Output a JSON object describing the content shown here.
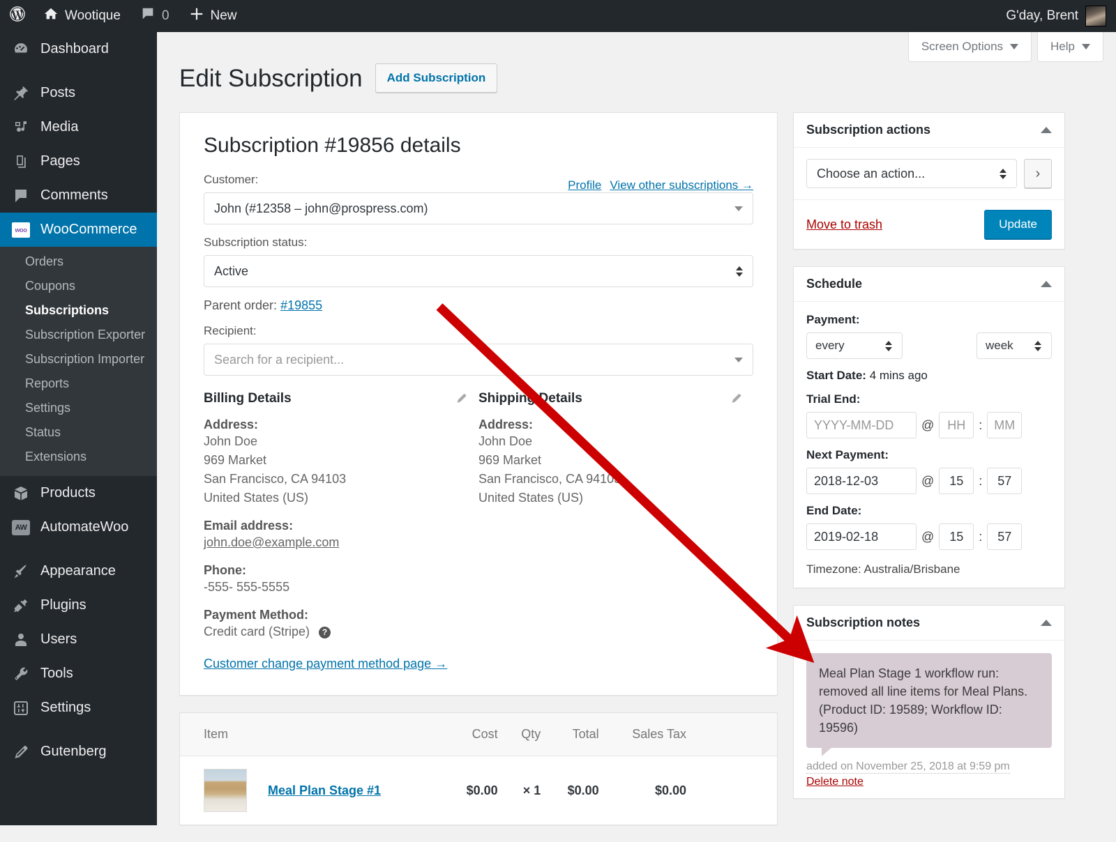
{
  "adminbar": {
    "logo_icon": "wordpress-logo-icon",
    "site_icon": "home-icon",
    "site_name": "Wootique",
    "comments_icon": "comment-bubble-icon",
    "comments_count": "0",
    "new_icon": "plus-icon",
    "new_label": "New",
    "greeting": "G'day, Brent",
    "avatar_icon": "user-avatar"
  },
  "sidebar": {
    "items": [
      {
        "label": "Dashboard",
        "icon": "dashboard-icon"
      },
      {
        "label": "Posts",
        "icon": "pin-icon"
      },
      {
        "label": "Media",
        "icon": "media-icon"
      },
      {
        "label": "Pages",
        "icon": "pages-icon"
      },
      {
        "label": "Comments",
        "icon": "comment-icon"
      },
      {
        "label": "WooCommerce",
        "icon": "woocommerce-icon"
      },
      {
        "label": "Products",
        "icon": "products-box-icon"
      },
      {
        "label": "AutomateWoo",
        "icon": "automatewoo-icon"
      },
      {
        "label": "Appearance",
        "icon": "paintbrush-icon"
      },
      {
        "label": "Plugins",
        "icon": "plug-icon"
      },
      {
        "label": "Users",
        "icon": "user-icon"
      },
      {
        "label": "Tools",
        "icon": "wrench-icon"
      },
      {
        "label": "Settings",
        "icon": "sliders-icon"
      },
      {
        "label": "Gutenberg",
        "icon": "pencil-icon"
      }
    ],
    "submenu": [
      "Orders",
      "Coupons",
      "Subscriptions",
      "Subscription Exporter",
      "Subscription Importer",
      "Reports",
      "Settings",
      "Status",
      "Extensions"
    ],
    "submenu_current": "Subscriptions",
    "current_item": "WooCommerce"
  },
  "screen_meta": {
    "screen_options": "Screen Options",
    "help": "Help"
  },
  "page": {
    "title": "Edit Subscription",
    "add_button": "Add Subscription"
  },
  "order_panel": {
    "heading": "Subscription #19856 details",
    "customer_label": "Customer:",
    "profile_link": "Profile",
    "other_subs_link": "View other subscriptions →",
    "customer_value": "John (#12358 – john@prospress.com)",
    "status_label": "Subscription status:",
    "status_value": "Active",
    "parent_order_label": "Parent order:",
    "parent_order_link": "#19855",
    "recipient_label": "Recipient:",
    "recipient_placeholder": "Search for a recipient...",
    "billing": {
      "heading": "Billing Details",
      "edit_icon": "pencil-edit-icon",
      "address_label": "Address:",
      "address_lines": [
        "John Doe",
        "969 Market",
        "San Francisco, CA 94103",
        "United States (US)"
      ],
      "email_label": "Email address:",
      "email_value": "john.doe@example.com",
      "phone_label": "Phone:",
      "phone_value": "-555- 555-5555",
      "payment_label": "Payment Method:",
      "payment_value": "Credit card (Stripe)",
      "payment_help_icon": "help-icon",
      "change_payment_link": "Customer change payment method page →"
    },
    "shipping": {
      "heading": "Shipping Details",
      "edit_icon": "pencil-edit-icon",
      "address_label": "Address:",
      "address_lines": [
        "John Doe",
        "969 Market",
        "San Francisco, CA 94103",
        "United States (US)"
      ]
    }
  },
  "items": {
    "columns": [
      "Item",
      "Cost",
      "Qty",
      "Total",
      "Sales Tax"
    ],
    "rows": [
      {
        "thumb_icon": "product-thumbnail",
        "name": "Meal Plan Stage #1",
        "cost": "$0.00",
        "qty": "× 1",
        "total": "$0.00",
        "sales_tax": "$0.00"
      }
    ]
  },
  "actions_box": {
    "title": "Subscription actions",
    "collapse_icon": "triangle-up-icon",
    "action_select": "Choose an action...",
    "go_icon": "chevron-right-icon",
    "trash_link": "Move to trash",
    "update_button": "Update"
  },
  "schedule_box": {
    "title": "Schedule",
    "collapse_icon": "triangle-up-icon",
    "payment_label": "Payment:",
    "interval_value": "every",
    "period_value": "week",
    "start_date_label": "Start Date:",
    "start_date_value": "4 mins ago",
    "trial_end_label": "Trial End:",
    "trial_end_date": "YYYY-MM-DD",
    "trial_end_hh": "HH",
    "trial_end_mm": "MM",
    "next_payment_label": "Next Payment:",
    "next_payment_date": "2018-12-03",
    "next_payment_hh": "15",
    "next_payment_mm": "57",
    "end_date_label": "End Date:",
    "end_date_date": "2019-02-18",
    "end_date_hh": "15",
    "end_date_mm": "57",
    "at_symbol": "@",
    "colon": ":",
    "timezone": "Timezone: Australia/Brisbane"
  },
  "notes_box": {
    "title": "Subscription notes",
    "collapse_icon": "triangle-up-icon",
    "note_text": "Meal Plan Stage 1 workflow run: removed all line items for Meal Plans. (Product ID: 19589; Workflow ID: 19596)",
    "note_meta": "added on November 25, 2018 at 9:59 pm",
    "delete_link": "Delete note"
  },
  "annotation": {
    "arrow_icon": "red-pointer-arrow",
    "arrow_color": "#cc0000"
  },
  "colors": {
    "admin_dark": "#23282d",
    "accent_blue": "#0073aa",
    "button_blue": "#0085ba",
    "danger_red": "#a00",
    "note_bg": "#d7cbd4"
  }
}
